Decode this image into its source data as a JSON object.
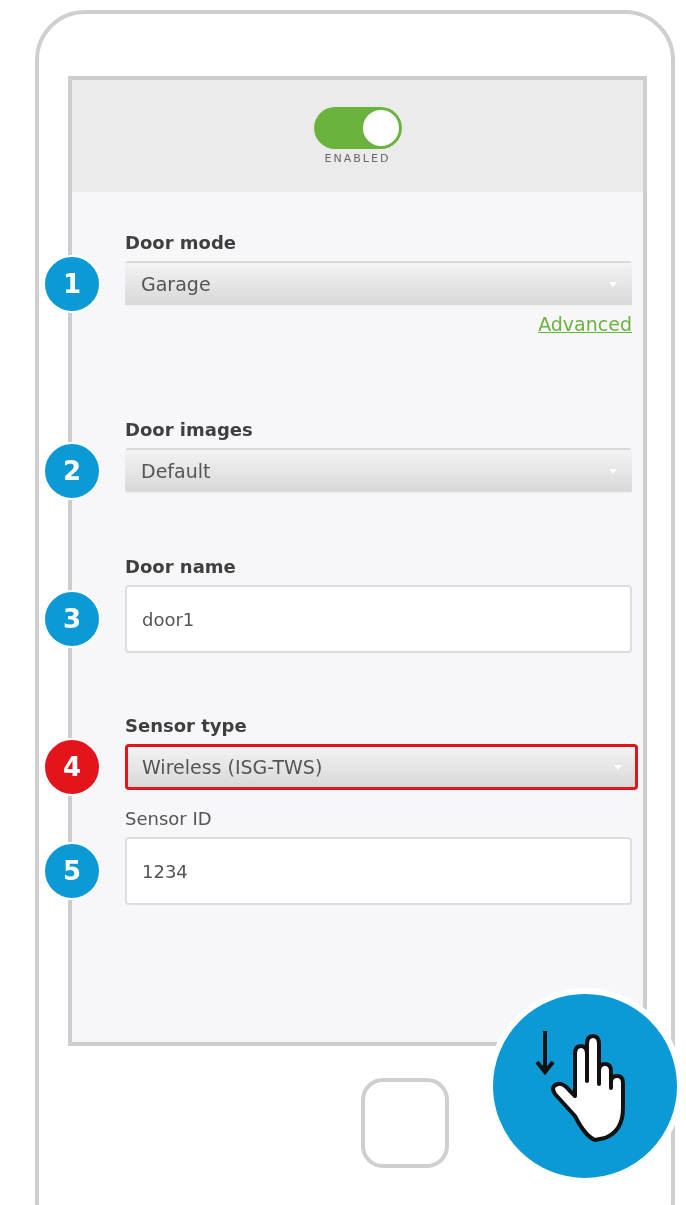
{
  "header": {
    "toggle": {
      "on": true,
      "label": "ENABLED"
    }
  },
  "fields": [
    {
      "kind": "select",
      "label": "Door mode",
      "value": "Garage",
      "marker": {
        "number": "1",
        "color": "#0b9ad6"
      },
      "highlighted": false,
      "label_bold": true,
      "link": "Advanced"
    },
    {
      "kind": "select",
      "label": "Door images",
      "value": "Default",
      "marker": {
        "number": "2",
        "color": "#0b9ad6"
      },
      "highlighted": false,
      "label_bold": true
    },
    {
      "kind": "text",
      "label": "Door name",
      "value": "door1",
      "marker": {
        "number": "3",
        "color": "#0b9ad6"
      },
      "highlighted": false,
      "label_bold": true
    },
    {
      "kind": "select",
      "label": "Sensor type",
      "value": "Wireless (ISG-TWS)",
      "marker": {
        "number": "4",
        "color": "#e3141b"
      },
      "highlighted": true,
      "label_bold": true
    },
    {
      "kind": "text",
      "label": "Sensor ID",
      "value": "1234",
      "marker": {
        "number": "5",
        "color": "#0b9ad6"
      },
      "highlighted": false,
      "label_bold": false
    }
  ]
}
